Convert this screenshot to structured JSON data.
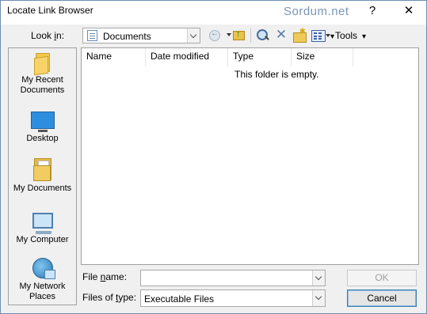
{
  "window": {
    "title": "Locate Link Browser",
    "watermark": "Sordum.net",
    "help": "?",
    "close": "✕"
  },
  "toolbar": {
    "look_in_label_pre": "Look ",
    "look_in_label_key": "i",
    "look_in_label_post": "n:",
    "look_in_value": "Documents",
    "tools_label": "Tools",
    "icons": [
      "back-icon",
      "up-folder-icon",
      "search-web-icon",
      "delete-icon",
      "new-folder-icon",
      "views-icon"
    ]
  },
  "places": [
    {
      "line1": "My Recent",
      "line2": "Documents",
      "icon": "recent-documents-icon"
    },
    {
      "line1": "Desktop",
      "line2": "",
      "icon": "desktop-icon"
    },
    {
      "line1": "My Documents",
      "line2": "",
      "icon": "my-documents-icon"
    },
    {
      "line1": "My Computer",
      "line2": "",
      "icon": "my-computer-icon"
    },
    {
      "line1": "My Network",
      "line2": "Places",
      "icon": "network-places-icon"
    }
  ],
  "file_list": {
    "columns": [
      "Name",
      "Date modified",
      "Type",
      "Size"
    ],
    "empty_message": "This folder is empty."
  },
  "footer": {
    "file_name_label_pre": "File ",
    "file_name_label_key": "n",
    "file_name_label_post": "ame:",
    "file_name_value": "",
    "file_type_label_pre": "Files of ",
    "file_type_label_key": "t",
    "file_type_label_post": "ype:",
    "file_type_value": "Executable Files",
    "ok_label": "OK",
    "cancel_label": "Cancel"
  }
}
